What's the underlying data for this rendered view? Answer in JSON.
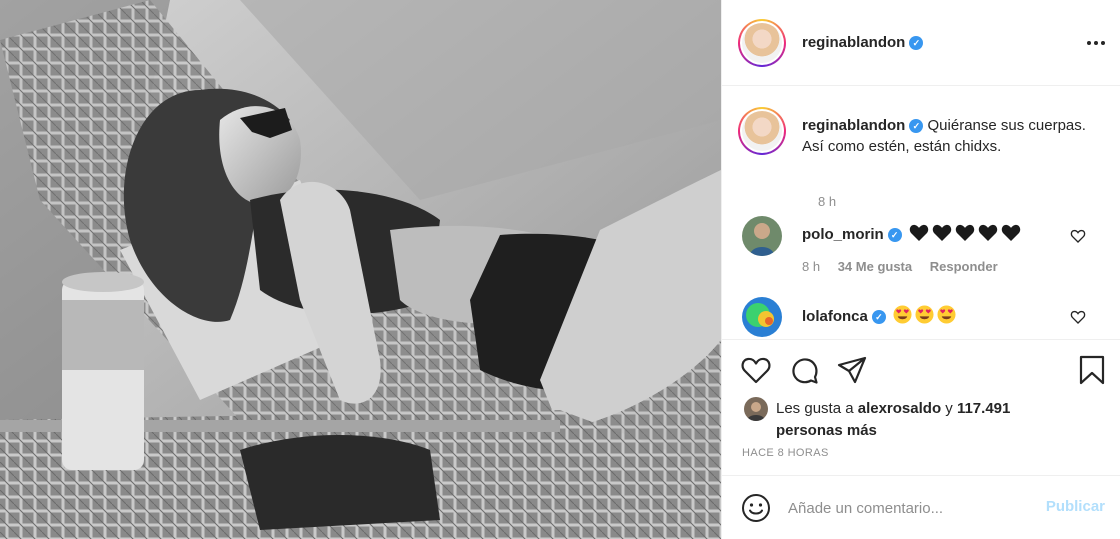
{
  "post": {
    "author": "reginablandon",
    "more_icon": "more-horizontal-icon",
    "verified_icon": "verified-badge-icon"
  },
  "caption": {
    "user": "reginablandon",
    "text": "Quiéranse sus cuerpas. Así como estén, están chidxs.",
    "time": "8 h"
  },
  "comments": [
    {
      "user": "polo_morin",
      "emoji": [
        "black-heart",
        "black-heart",
        "black-heart",
        "black-heart",
        "black-heart"
      ],
      "time": "8 h",
      "likes": "34 Me gusta",
      "reply": "Responder"
    },
    {
      "user": "lolafonca",
      "emoji": [
        "heart-eyes",
        "heart-eyes",
        "heart-eyes"
      ]
    }
  ],
  "actions": {
    "like_icon": "heart-icon",
    "comment_icon": "comment-bubble-icon",
    "share_icon": "paper-plane-icon",
    "save_icon": "bookmark-icon"
  },
  "likes": {
    "prefix": "Les gusta a",
    "user": "alexrosaldo",
    "connector": "y",
    "count": "117.491 personas más"
  },
  "timestamp": "HACE 8 HORAS",
  "comment_box": {
    "placeholder": "Añade un comentario...",
    "publish_label": "Publicar"
  },
  "colors": {
    "text": "#262626",
    "secondary": "#8e8e8e",
    "verified": "#3897f0",
    "publish_disabled": "#b2dffc",
    "divider": "#efefef"
  }
}
